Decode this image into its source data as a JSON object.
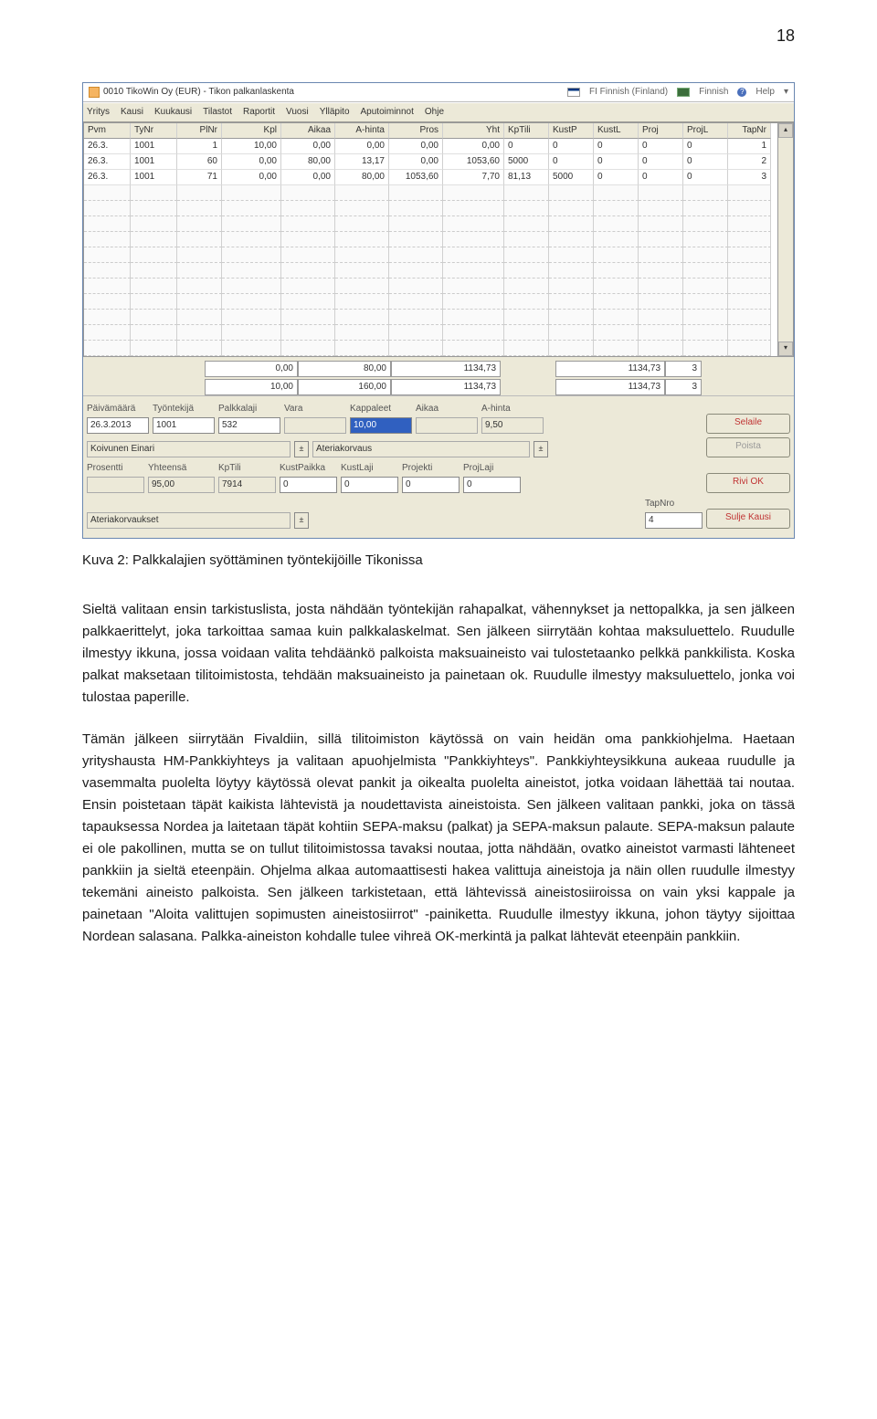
{
  "page_number": "18",
  "screenshot": {
    "title": "0010 TikoWin Oy (EUR)  -  Tikon palkanlaskenta",
    "lang_indicator": "FI  Finnish (Finland)",
    "finnish_btn": "Finnish",
    "help_btn": "Help",
    "menu": [
      "Yritys",
      "Kausi",
      "Kuukausi",
      "Tilastot",
      "Raportit",
      "Vuosi",
      "Ylläpito",
      "Aputoiminnot",
      "Ohje"
    ],
    "grid_headers": [
      "Pvm",
      "TyNr",
      "PlNr",
      "Kpl",
      "Aikaa",
      "A-hinta",
      "Pros",
      "Yht",
      "KpTili",
      "KustP",
      "KustL",
      "Proj",
      "ProjL",
      "TapNr"
    ],
    "grid_rows": [
      {
        "pvm": "26.3.",
        "tynr": "1001",
        "pinr": "1",
        "kpl": "10,00",
        "aikaa": "0,00",
        "ahinta": "0,00",
        "pros": "0,00",
        "yht": "0,00",
        "kptili": "0",
        "kustp": "0",
        "kustl": "0",
        "proj": "0",
        "projl": "0",
        "tapnr": "1"
      },
      {
        "pvm": "26.3.",
        "tynr": "1001",
        "pinr": "60",
        "kpl": "0,00",
        "aikaa": "80,00",
        "ahinta": "13,17",
        "pros": "0,00",
        "yht": "1053,60",
        "kptili": "5000",
        "kustp": "0",
        "kustl": "0",
        "proj": "0",
        "projl": "0",
        "tapnr": "2"
      },
      {
        "pvm": "26.3.",
        "tynr": "1001",
        "pinr": "71",
        "kpl": "0,00",
        "aikaa": "0,00",
        "ahinta": "80,00",
        "pros": "1053,60",
        "yht": "7,70",
        "kptili": "81,13",
        "kustp": "5000",
        "kustl": "0",
        "proj": "0",
        "projl": "0",
        "tapnr": "3"
      }
    ],
    "totals": {
      "row1": {
        "c1": "0,00",
        "c2": "80,00",
        "c3": "1134,73",
        "c4": "1134,73",
        "c5": "3"
      },
      "row2": {
        "c1": "10,00",
        "c2": "160,00",
        "c3": "1134,73",
        "c4": "1134,73",
        "c5": "3"
      }
    },
    "form": {
      "paivamaara_lbl": "Päivämäärä",
      "paivamaara": "26.3.2013",
      "tyontekija_lbl": "Työntekijä",
      "tyontekija": "1001",
      "palkkalaji_lbl": "Palkkalaji",
      "palkkalaji": "532",
      "vara_lbl": "Vara",
      "vara": "",
      "kappaleet_lbl": "Kappaleet",
      "kappaleet": "10,00",
      "aikaa_lbl": "Aikaa",
      "aikaa": "",
      "ahinta_lbl": "A-hinta",
      "ahinta": "9,50",
      "nimi": "Koivunen Einari",
      "kuvaus": "Ateriakorvaus",
      "prosentti_lbl": "Prosentti",
      "prosentti": "",
      "yhteensa_lbl": "Yhteensä",
      "yhteensa": "95,00",
      "kptili_lbl": "KpTili",
      "kptili": "7914",
      "kustpaikka_lbl": "KustPaikka",
      "kustpaikka": "0",
      "kustlaji_lbl": "KustLaji",
      "kustlaji": "0",
      "projekti_lbl": "Projekti",
      "projekti": "0",
      "projlaji_lbl": "ProjLaji",
      "projlaji": "0",
      "ateriakorvaukset": "Ateriakorvaukset",
      "tapnro_lbl": "TapNro",
      "tapnro": "4",
      "btn_selaile": "Selaile",
      "btn_poista": "Poista",
      "btn_riviok": "Rivi OK",
      "btn_sulje": "Sulje Kausi"
    }
  },
  "caption": "Kuva 2: Palkkalajien syöttäminen työntekijöille Tikonissa",
  "para1": "Sieltä valitaan ensin tarkistuslista, josta nähdään työntekijän rahapalkat, vähennykset ja nettopalkka, ja sen jälkeen palkkaerittelyt, joka tarkoittaa samaa kuin palkkalaskelmat. Sen jälkeen siirrytään kohtaa maksuluettelo. Ruudulle ilmestyy ikkuna, jossa voidaan valita tehdäänkö palkoista maksuaineisto vai tulostetaanko pelkkä pankkilista. Koska palkat maksetaan tilitoimistosta, tehdään maksuaineisto ja painetaan ok. Ruudulle ilmestyy maksuluettelo, jonka voi tulostaa paperille.",
  "para2": "Tämän jälkeen siirrytään Fivaldiin, sillä tilitoimiston käytössä on vain heidän oma pankkiohjelma. Haetaan yrityshausta HM-Pankkiyhteys ja valitaan apuohjelmista \"Pankkiyhteys\". Pankkiyhteysikkuna aukeaa ruudulle ja vasemmalta puolelta löytyy käytössä olevat pankit ja oikealta puolelta aineistot, jotka voidaan lähettää tai noutaa. Ensin poistetaan täpät kaikista lähtevistä ja noudettavista aineistoista. Sen jälkeen valitaan pankki, joka on tässä tapauksessa Nordea ja laitetaan täpät kohtiin SEPA-maksu (palkat) ja SEPA-maksun palaute. SEPA-maksun palaute ei ole pakollinen, mutta se on tullut tilitoimistossa tavaksi noutaa, jotta nähdään, ovatko aineistot varmasti lähteneet pankkiin ja sieltä eteenpäin. Ohjelma alkaa automaattisesti hakea valittuja aineistoja ja näin ollen ruudulle ilmestyy tekemäni aineisto palkoista. Sen jälkeen tarkistetaan, että lähtevissä aineistosiiroissa on vain yksi kappale ja painetaan \"Aloita valittujen sopimusten aineistosiirrot\" -painiketta. Ruudulle ilmestyy ikkuna, johon täytyy sijoittaa Nordean salasana. Palkka-aineiston kohdalle tulee vihreä OK-merkintä ja palkat lähtevät eteenpäin pankkiin."
}
